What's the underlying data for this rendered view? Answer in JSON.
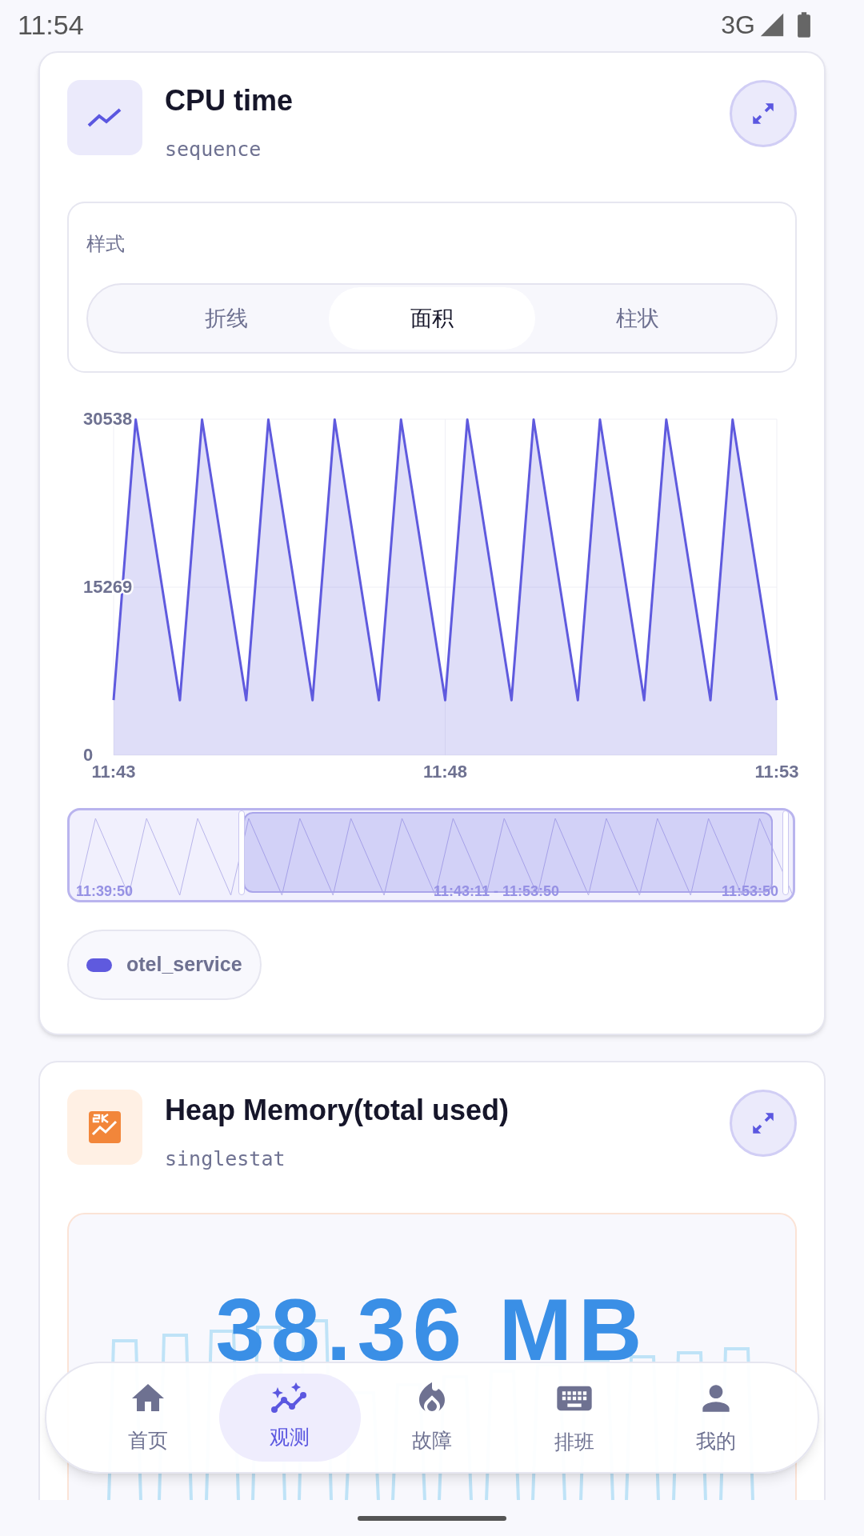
{
  "status_bar": {
    "time": "11:54",
    "network": "3G"
  },
  "panels": [
    {
      "kind": "chart",
      "title": "CPU time",
      "subtitle": "sequence",
      "style": {
        "label": "样式",
        "options": [
          {
            "label": "折线",
            "selected": false
          },
          {
            "label": "面积",
            "selected": true
          },
          {
            "label": "柱状",
            "selected": false
          }
        ]
      },
      "chart_data": {
        "type": "area",
        "categories": [
          "11:43",
          null,
          null,
          null,
          null,
          null,
          null,
          null,
          null,
          null,
          null,
          null,
          null,
          null,
          null,
          "11:48",
          null,
          null,
          null,
          null,
          null,
          null,
          null,
          null,
          null,
          null,
          null,
          null,
          null,
          null,
          "11:53"
        ],
        "series": [
          {
            "name": "otel_service",
            "color": "#5f5ade",
            "values": [
              5000,
              30500,
              17750,
              5000,
              30500,
              17750,
              5000,
              30500,
              17750,
              5000,
              30500,
              17750,
              5000,
              30500,
              17750,
              5000,
              30500,
              17750,
              5000,
              30500,
              17750,
              5000,
              30500,
              17750,
              5000,
              30500,
              17750,
              5000,
              30500,
              17750,
              5000
            ]
          }
        ],
        "ylim": [
          0,
          30538
        ],
        "yticks": [
          0,
          15269,
          30538
        ]
      },
      "brush": {
        "start": "11:39:50",
        "range": "11:43:11 - 11:53:50",
        "end": "11:53:50"
      }
    },
    {
      "kind": "stat",
      "title": "Heap Memory(total used)",
      "subtitle": "singlestat",
      "value": "38.36 MB"
    }
  ],
  "nav": [
    {
      "label": "首页",
      "selected": false
    },
    {
      "label": "观测",
      "selected": true
    },
    {
      "label": "故障",
      "selected": false
    },
    {
      "label": "排班",
      "selected": false
    },
    {
      "label": "我的",
      "selected": false
    }
  ]
}
